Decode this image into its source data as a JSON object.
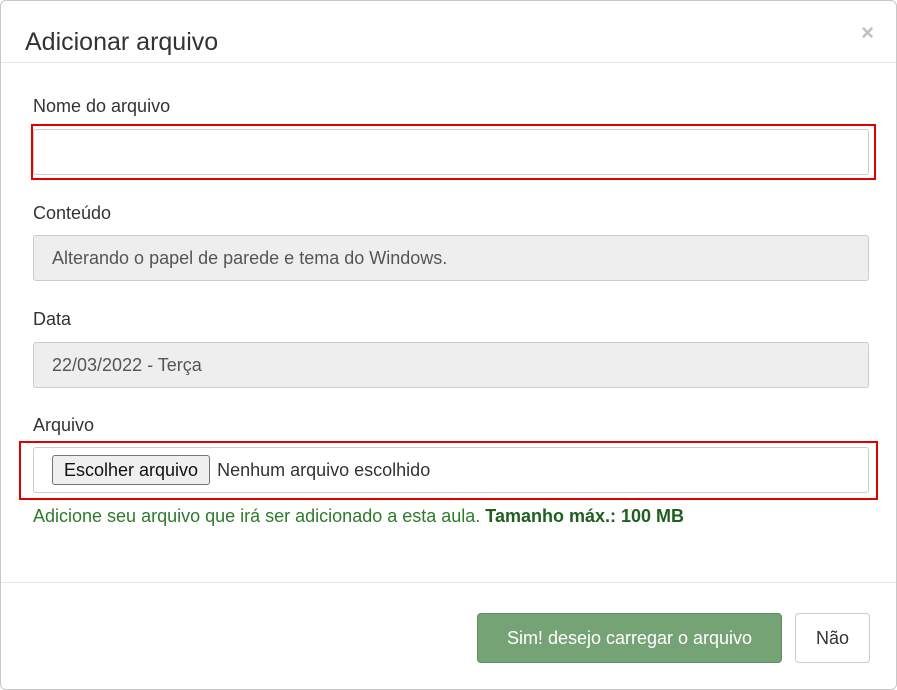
{
  "dialog": {
    "title": "Adicionar arquivo",
    "close_glyph": "×",
    "close_icon": "close-icon"
  },
  "form": {
    "name": {
      "label": "Nome do arquivo",
      "value": "",
      "placeholder": ""
    },
    "content": {
      "label": "Conteúdo",
      "value": "Alterando o papel de parede e tema do Windows."
    },
    "date": {
      "label": "Data",
      "value": "22/03/2022 - Terça"
    },
    "file": {
      "label": "Arquivo",
      "button_label": "Escolher arquivo",
      "status": "Nenhum arquivo escolhido"
    },
    "help": {
      "text": "Adicione seu arquivo que irá ser adicionado a esta aula.",
      "max_size": "Tamanho máx.: 100 MB"
    }
  },
  "footer": {
    "confirm_label": "Sim! desejo carregar o arquivo",
    "cancel_label": "Não"
  },
  "colors": {
    "highlight": "#e00000",
    "primary_button": "#76a376",
    "help_text": "#2d7a2d"
  }
}
